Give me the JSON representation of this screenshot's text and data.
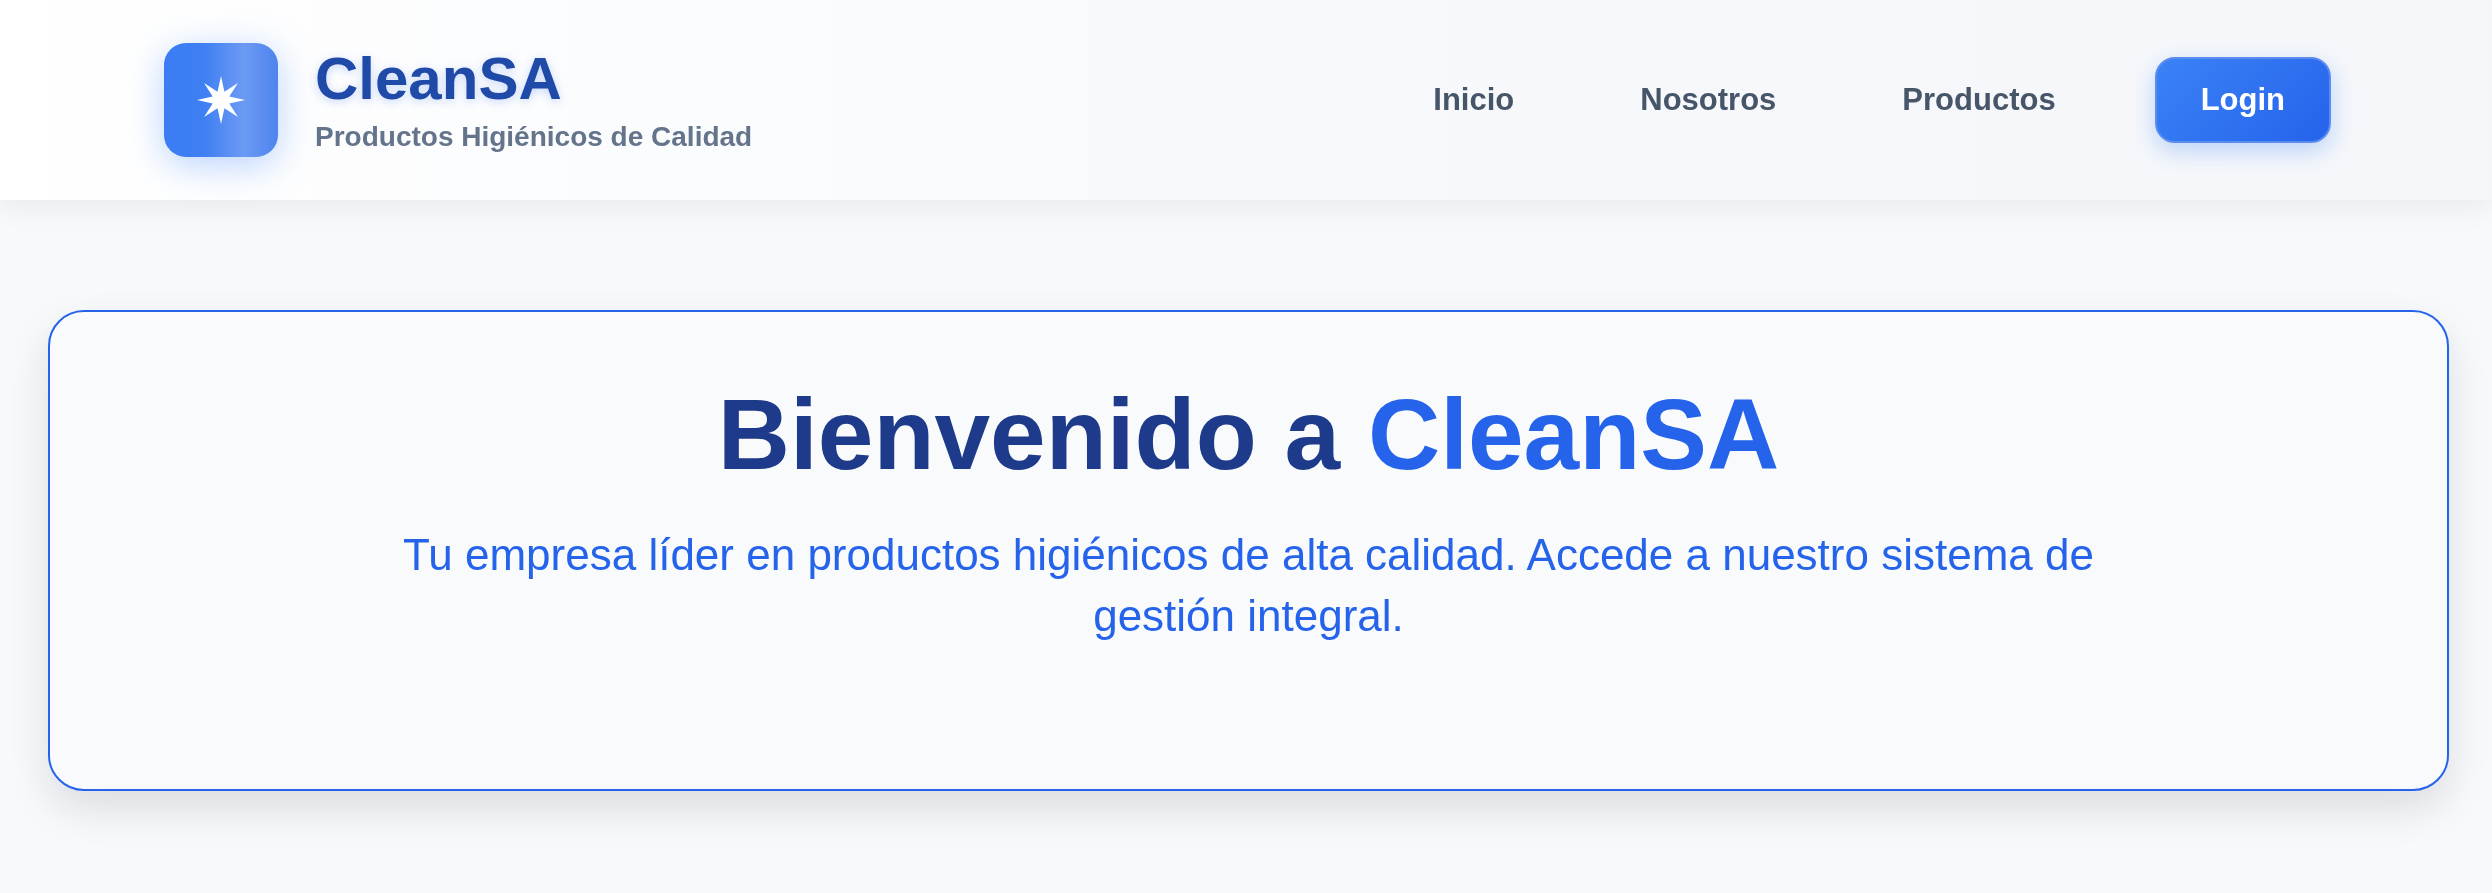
{
  "header": {
    "logo": {
      "title": "CleanSA",
      "subtitle": "Productos Higiénicos de Calidad"
    },
    "nav": [
      {
        "label": "Inicio",
        "kind": "link"
      },
      {
        "label": "Nosotros",
        "kind": "link"
      },
      {
        "label": "Productos",
        "kind": "link"
      },
      {
        "label": "Login",
        "kind": "button"
      }
    ]
  },
  "hero": {
    "title": "Bienvenido a",
    "title_highlight": "CleanSA",
    "description": "Tu empresa líder en productos higiénicos de alta calidad. Accede a nuestro sistema de gestión integral."
  }
}
